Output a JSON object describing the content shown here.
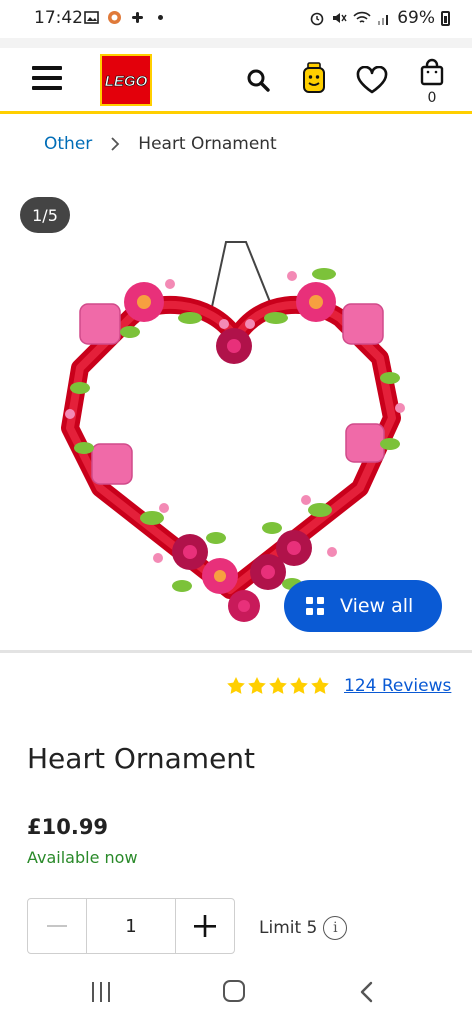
{
  "status_bar": {
    "time": "17:42",
    "battery": "69%"
  },
  "header": {
    "logo_text": "LEGO",
    "bag_count": "0"
  },
  "breadcrumb": {
    "parent": "Other",
    "current": "Heart Ornament"
  },
  "gallery": {
    "counter": "1/5",
    "view_all_label": "View all"
  },
  "rating": {
    "stars": 5,
    "reviews_label": "124 Reviews",
    "star_color": "#ffcf00"
  },
  "product": {
    "title": "Heart Ornament",
    "price": "£10.99",
    "availability": "Available now"
  },
  "quantity": {
    "minus": "−",
    "value": "1",
    "plus": "+",
    "limit_label": "Limit 5",
    "info": "i"
  },
  "colors": {
    "accent": "#0a5ad4",
    "brand_red": "#e3000b",
    "brand_yellow": "#ffcf00",
    "available_green": "#2a8a2a"
  }
}
